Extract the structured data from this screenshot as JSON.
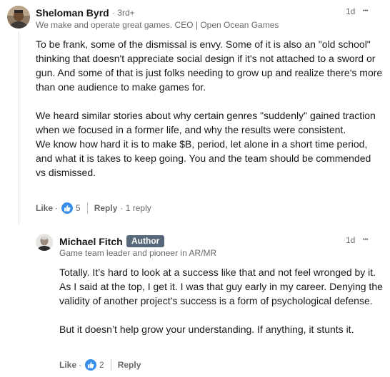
{
  "comment": {
    "author": "Sheloman Byrd",
    "degree": "· 3rd+",
    "headline": "We make and operate great games. CEO | Open Ocean Games",
    "time": "1d",
    "more": "•••",
    "paragraphs": [
      "To be frank, some of the dismissal is envy. Some of it is also an \"old school\" thinking that doesn't appreciate social design if it's not attached to a sword or gun. And some of that is just folks needing to grow up and realize there's more than one audience to make games for.",
      "We heard similar stories about why certain genres \"suddenly\" gained traction when we focused in a former life, and why the results were consistent.",
      "We know how hard it is to make $B, period, let alone in a short time period, and what it is takes to keep going. You and the team should be commended vs dismissed."
    ],
    "actions": {
      "like": "Like",
      "dot": "·",
      "reaction_count": "5",
      "reply": "Reply",
      "replies": "· 1 reply"
    }
  },
  "reply": {
    "author": "Michael Fitch",
    "badge": "Author",
    "headline": "Game team leader and pioneer in AR/MR",
    "time": "1d",
    "more": "•••",
    "paragraphs": [
      "Totally. It’s hard to look at a success like that and not feel wronged by it. As I said at the top, I get it. I was that guy early in my career. Denying the validity of another project’s success is a form of psychological defense.",
      "But it doesn’t help grow your understanding. If anything, it stunts it."
    ],
    "actions": {
      "like": "Like",
      "dot": "·",
      "reaction_count": "2",
      "reply": "Reply"
    }
  },
  "colors": {
    "badge_bg": "#56687a",
    "reaction_blue": "#378fe9",
    "thread_line": "#e0dfdc"
  },
  "icons": {
    "reaction": "thumbs-up-icon",
    "menu": "more-options-icon"
  }
}
